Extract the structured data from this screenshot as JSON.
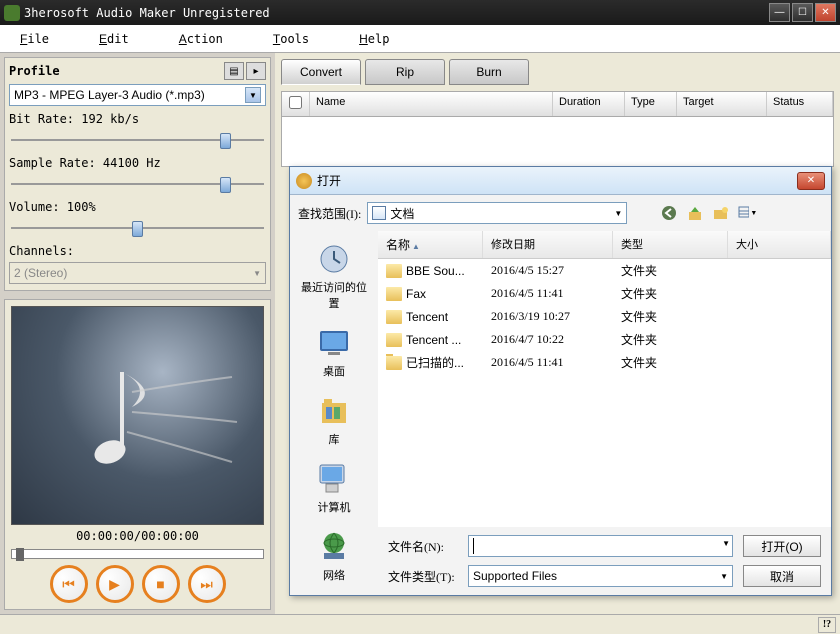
{
  "app": {
    "title": "3herosoft Audio Maker Unregistered"
  },
  "menu": {
    "file": "File",
    "edit": "Edit",
    "action": "Action",
    "tools": "Tools",
    "help": "Help"
  },
  "profile": {
    "header": "Profile",
    "format": "MP3 - MPEG Layer-3 Audio  (*.mp3)",
    "bitrate_label": "Bit Rate: 192 kb/s",
    "samplerate_label": "Sample Rate: 44100 Hz",
    "volume_label": "Volume: 100%",
    "channels_label": "Channels:",
    "channels_value": "2 (Stereo)"
  },
  "preview": {
    "timecode": "00:00:00/00:00:00"
  },
  "tabs": {
    "convert": "Convert",
    "rip": "Rip",
    "burn": "Burn"
  },
  "list_headers": {
    "name": "Name",
    "duration": "Duration",
    "type": "Type",
    "target": "Target",
    "status": "Status"
  },
  "dialog": {
    "title": "打开",
    "lookin_label": "查找范围(I):",
    "lookin_value": "文档",
    "places": {
      "recent": "最近访问的位置",
      "desktop": "桌面",
      "library": "库",
      "computer": "计算机",
      "network": "网络"
    },
    "cols": {
      "name": "名称",
      "date": "修改日期",
      "type": "类型",
      "size": "大小"
    },
    "rows": [
      {
        "name": "BBE Sou...",
        "date": "2016/4/5 15:27",
        "type": "文件夹"
      },
      {
        "name": "Fax",
        "date": "2016/4/5 11:41",
        "type": "文件夹"
      },
      {
        "name": "Tencent",
        "date": "2016/3/19 10:27",
        "type": "文件夹"
      },
      {
        "name": "Tencent ...",
        "date": "2016/4/7 10:22",
        "type": "文件夹"
      },
      {
        "name": "已扫描的...",
        "date": "2016/4/5 11:41",
        "type": "文件夹"
      }
    ],
    "filename_label": "文件名(N):",
    "filetype_label": "文件类型(T):",
    "filetype_value": "Supported Files",
    "open_btn": "打开(O)",
    "cancel_btn": "取消"
  },
  "status": {
    "grip": "!?"
  }
}
